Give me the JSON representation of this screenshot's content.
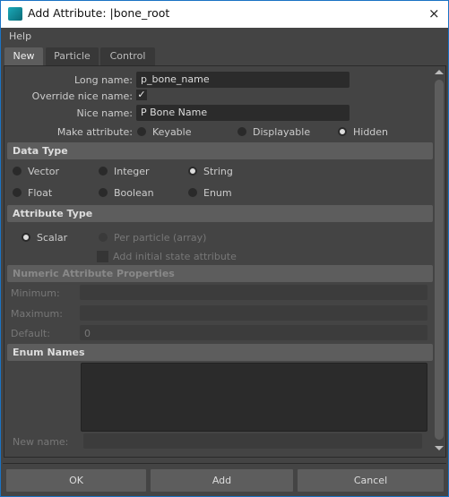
{
  "window": {
    "title": "Add Attribute: |bone_root",
    "close_icon": "×"
  },
  "menu": {
    "help": "Help"
  },
  "tabs": [
    {
      "label": "New",
      "active": true
    },
    {
      "label": "Particle"
    },
    {
      "label": "Control"
    }
  ],
  "form": {
    "long_name_label": "Long name:",
    "long_name_value": "p_bone_name",
    "override_label": "Override nice name:",
    "override_checked": true,
    "check_glyph": "✓",
    "nice_name_label": "Nice name:",
    "nice_name_value": "P Bone Name",
    "make_attr_label": "Make attribute:",
    "make_attr_options": [
      "Keyable",
      "Displayable",
      "Hidden"
    ],
    "make_attr_selected": "Hidden"
  },
  "data_type": {
    "header": "Data Type",
    "options": [
      "Vector",
      "Integer",
      "String",
      "Float",
      "Boolean",
      "Enum"
    ],
    "selected": "String"
  },
  "attribute_type": {
    "header": "Attribute Type",
    "scalar": "Scalar",
    "per_particle": "Per particle (array)",
    "initial_state": "Add initial state attribute",
    "selected": "Scalar"
  },
  "numeric": {
    "header": "Numeric Attribute Properties",
    "minimum": "Minimum:",
    "maximum": "Maximum:",
    "default": "Default:",
    "default_value": "0"
  },
  "enum": {
    "header": "Enum Names",
    "new_name": "New name:"
  },
  "buttons": {
    "ok": "OK",
    "add": "Add",
    "cancel": "Cancel"
  }
}
